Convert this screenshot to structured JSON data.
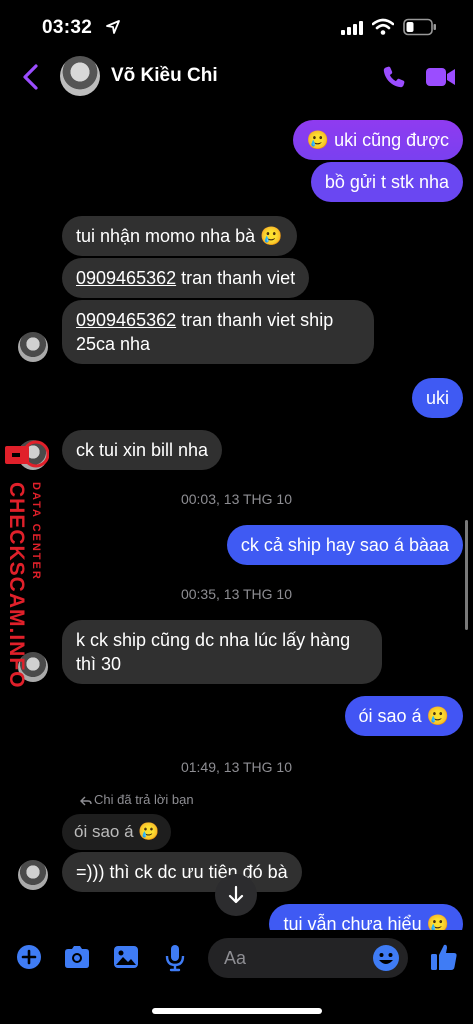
{
  "status_bar": {
    "time": "03:32"
  },
  "header": {
    "contact_name": "Võ Kiều Chi"
  },
  "messages": {
    "m1": "🥲 uki cũng được",
    "m2": "bồ gửi t stk nha",
    "m3": "tui nhận momo nha bà 🥲",
    "m4_phone": "0909465362",
    "m4_rest": " tran thanh viet",
    "m5_phone": "0909465362",
    "m5_rest": " tran thanh viet ship",
    "m5_line2": "25ca nha",
    "m6": "uki",
    "m7": "ck tui xin bill nha",
    "ts1": "00:03, 13 THG 10",
    "m8": "ck cả ship hay sao á bàaa",
    "ts2": "00:35, 13 THG 10",
    "m9_line1": "k ck ship cũng dc nha lúc lấy hàng",
    "m9_line2": "thì 30",
    "m10": "ói sao á 🥲",
    "ts3": "01:49, 13 THG 10",
    "reply_note": "Chi đã trả lời bạn",
    "reply_quote": "ói sao á 🥲",
    "m11": "=))) thì ck dc ưu tiên đó bà",
    "m12": "tui vẫn chưa hiểu 🥲"
  },
  "watermark": {
    "main": "CHECKSCAM.INFO",
    "sub": "DATA CENTER"
  },
  "composer": {
    "placeholder": "Aa"
  },
  "colors": {
    "accent": "#9b4dff",
    "bubble_mine": "#3f5af3",
    "bubble_theirs": "#303030",
    "watermark": "#e0202a"
  }
}
